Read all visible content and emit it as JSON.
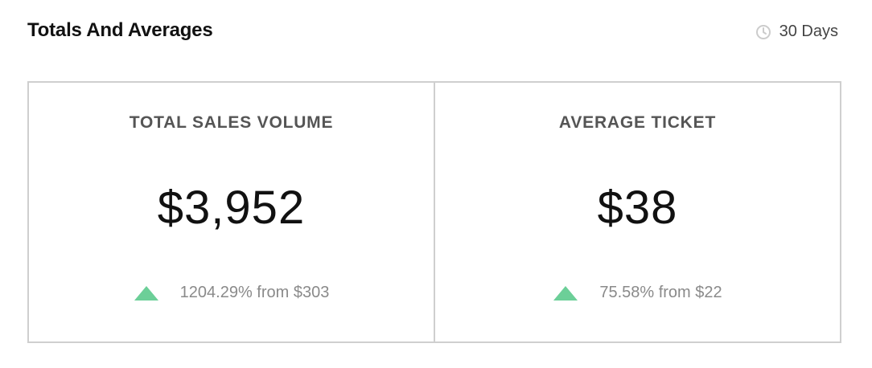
{
  "header": {
    "title": "Totals And Averages",
    "range_label": "30 Days"
  },
  "colors": {
    "up_triangle": "#6ccf98",
    "border": "#cfcfcf",
    "clock_icon": "#cccccc"
  },
  "cards": [
    {
      "label": "TOTAL SALES VOLUME",
      "value": "$3,952",
      "change_icon": "triangle-up-icon",
      "change_text": "1204.29% from $303"
    },
    {
      "label": "AVERAGE TICKET",
      "value": "$38",
      "change_icon": "triangle-up-icon",
      "change_text": "75.58% from $22"
    }
  ]
}
